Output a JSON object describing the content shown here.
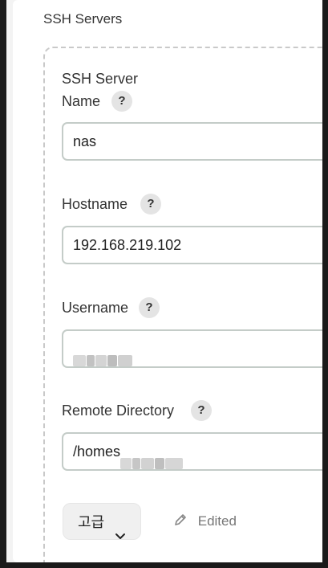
{
  "section": {
    "title": "SSH Servers"
  },
  "server": {
    "heading": "SSH Server",
    "help_glyph": "?",
    "fields": {
      "name": {
        "label": "Name",
        "value": "nas"
      },
      "hostname": {
        "label": "Hostname",
        "value": "192.168.219.102"
      },
      "username": {
        "label": "Username",
        "value": ""
      },
      "remote_directory": {
        "label": "Remote Directory",
        "value": "/homes"
      }
    }
  },
  "advanced": {
    "label": "고급",
    "icon": "chevron-down-icon"
  },
  "status": {
    "text": "Edited",
    "icon": "pencil-icon"
  }
}
